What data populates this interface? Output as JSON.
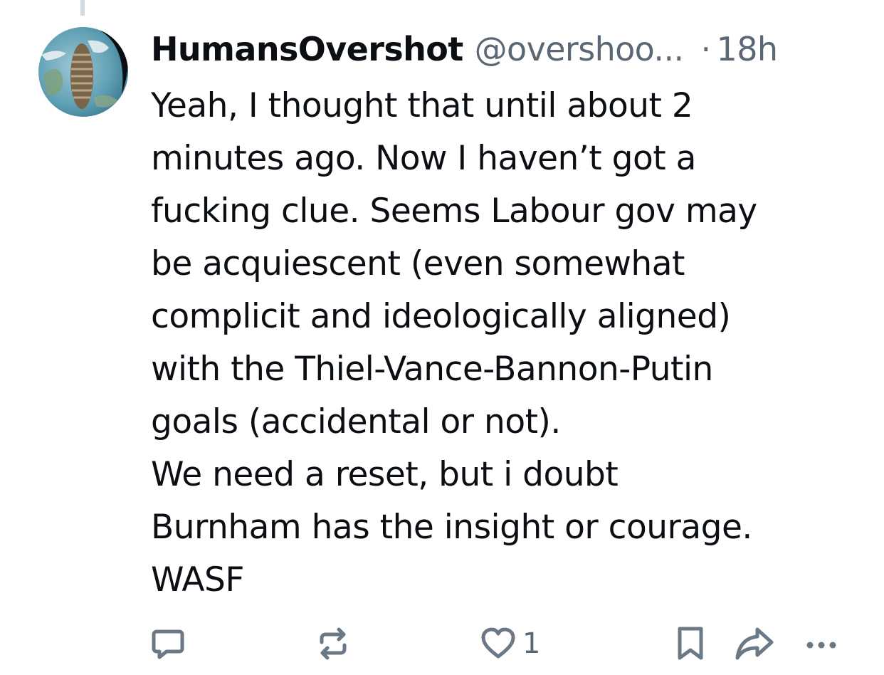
{
  "post": {
    "display_name": "HumansOvershot",
    "handle": "@overshoo...",
    "separator": "·",
    "time": "18h",
    "text": "Yeah, I thought that until about 2\nminutes ago. Now I haven’t got a\nfucking clue. Seems Labour gov may\nbe acquiescent (even somewhat\ncomplicit and ideologically aligned)\nwith the Thiel-Vance-Bannon-Putin\ngoals (accidental or not).\nWe need a reset, but i doubt\nBurnham has the insight or courage.\nWASF"
  },
  "actions": {
    "reply_icon": "reply-icon",
    "repost_icon": "repost-icon",
    "like_icon": "heart-icon",
    "like_count": "1",
    "bookmark_icon": "bookmark-icon",
    "share_icon": "share-icon",
    "more_icon": "more-icon"
  },
  "colors": {
    "text": "#0b0f14",
    "muted": "#5b6775",
    "icon": "#6b7886"
  }
}
